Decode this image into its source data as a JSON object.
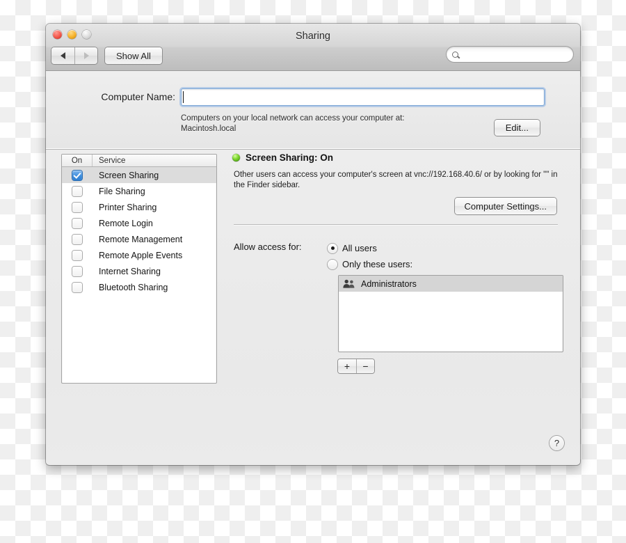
{
  "window": {
    "title": "Sharing",
    "traffic_lights": [
      "close-button",
      "minimize-button",
      "zoom-button"
    ]
  },
  "toolbar": {
    "back_icon": "triangle-left-icon",
    "forward_icon": "triangle-right-icon",
    "show_all_label": "Show All",
    "search": {
      "placeholder": "",
      "value": "",
      "icon": "search-icon"
    }
  },
  "computer_name": {
    "label": "Computer Name:",
    "value": "",
    "placeholder": "",
    "help_line1": "Computers on your local network can access your computer at:",
    "help_line2": "Macintosh.local",
    "edit_label": "Edit..."
  },
  "service_list": {
    "columns": [
      "On",
      "Service"
    ],
    "rows": [
      {
        "name": "Screen Sharing",
        "checked": true,
        "selected": true
      },
      {
        "name": "File Sharing",
        "checked": false,
        "selected": false
      },
      {
        "name": "Printer Sharing",
        "checked": false,
        "selected": false
      },
      {
        "name": "Remote Login",
        "checked": false,
        "selected": false
      },
      {
        "name": "Remote Management",
        "checked": false,
        "selected": false
      },
      {
        "name": "Remote Apple Events",
        "checked": false,
        "selected": false
      },
      {
        "name": "Internet Sharing",
        "checked": false,
        "selected": false
      },
      {
        "name": "Bluetooth Sharing",
        "checked": false,
        "selected": false
      }
    ]
  },
  "detail": {
    "status_indicator": "green-status-led",
    "status_color": "#7bd42c",
    "status_text": "Screen Sharing: On",
    "description": "Other users can access your computer's screen at vnc://192.168.40.6/ or by looking for \"\" in the Finder sidebar.",
    "computer_settings_label": "Computer Settings...",
    "access_label": "Allow access for:",
    "access_options": [
      {
        "label": "All users",
        "selected": true
      },
      {
        "label": "Only these users:",
        "selected": false
      }
    ],
    "users": [
      {
        "name": "Administrators",
        "icon": "group-icon",
        "selected": true
      }
    ],
    "add_label": "+",
    "remove_label": "−"
  },
  "footer": {
    "help_label": "?"
  },
  "colors": {
    "accent": "#3f8edd",
    "selection": "#dcdcdc",
    "status_green": "#7bd42c",
    "focus_ring": "#7ba7d7"
  }
}
